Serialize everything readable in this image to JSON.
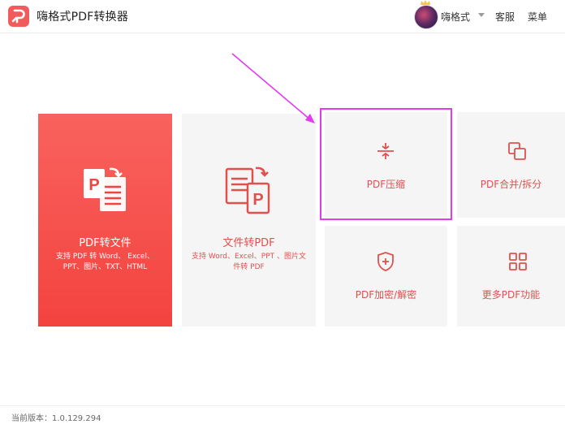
{
  "header": {
    "app_title": "嗨格式PDF转换器",
    "username": "嗨格式",
    "support_label": "客服",
    "menu_label": "菜单"
  },
  "tiles": {
    "pdf_to_file": {
      "label": "PDF转文件",
      "desc_line1": "支持 PDF 转 Word、 Excel、",
      "desc_line2": "PPT、图片、TXT、HTML"
    },
    "file_to_pdf": {
      "label": "文件转PDF",
      "desc_line1": "支持 Word、Excel、PPT 、图片文",
      "desc_line2": "件转 PDF"
    },
    "compress": {
      "label": "PDF压缩"
    },
    "merge_split": {
      "label": "PDF合并/拆分"
    },
    "encrypt": {
      "label": "PDF加密/解密"
    },
    "more": {
      "label": "更多PDF功能"
    }
  },
  "footer": {
    "version_text": "当前版本：1.0.129.294"
  },
  "colors": {
    "accent": "#f25b5b",
    "tile_bg": "#f5f5f5",
    "annotation": "#e23bf0"
  },
  "icons": {
    "logo": "app-logo-icon",
    "compress": "compress-icon",
    "merge": "merge-icon",
    "shield": "shield-plus-icon",
    "grid": "grid-icon"
  }
}
